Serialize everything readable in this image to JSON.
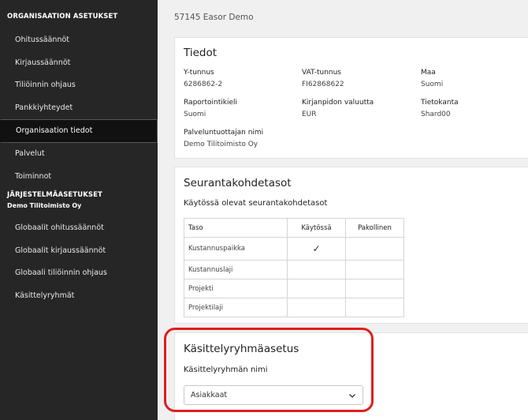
{
  "sidebar": {
    "org_header": "ORGANISAATION ASETUKSET",
    "org_items": [
      {
        "label": "Ohitussäännöt"
      },
      {
        "label": "Kirjaussäännöt"
      },
      {
        "label": "Tiliöinnin ohjaus"
      },
      {
        "label": "Pankkiyhteydet"
      },
      {
        "label": "Organisaation tiedot"
      },
      {
        "label": "Palvelut"
      },
      {
        "label": "Toiminnot"
      }
    ],
    "active_item": "Organisaation tiedot",
    "system_header": "JÄRJESTELMÄASETUKSET",
    "system_sub": "Demo Tilitoimisto Oy",
    "system_items": [
      {
        "label": "Globaalit ohitussäännöt"
      },
      {
        "label": "Globaalit kirjaussäännöt"
      },
      {
        "label": "Globaali tiliöinnin ohjaus"
      },
      {
        "label": "Käsittelyryhmät"
      }
    ]
  },
  "main": {
    "org_title": "57145 Easor Demo",
    "tiedot": {
      "title": "Tiedot",
      "fields": [
        {
          "label": "Y-tunnus",
          "value": "6286862-2"
        },
        {
          "label": "VAT-tunnus",
          "value": "FI62868622"
        },
        {
          "label": "Maa",
          "value": "Suomi"
        },
        {
          "label": "Raportointikieli",
          "value": "Suomi"
        },
        {
          "label": "Kirjanpidon valuutta",
          "value": "EUR"
        },
        {
          "label": "Tietokanta",
          "value": "Shard00"
        },
        {
          "label": "Palveluntuottajan nimi",
          "value": "Demo Tilitoimisto Oy"
        }
      ]
    },
    "seuranta": {
      "title": "Seurantakohdetasot",
      "subtitle": "Käytössä olevat seurantakohdetasot",
      "columns": [
        "Taso",
        "Käytössä",
        "Pakollinen"
      ],
      "rows": [
        {
          "taso": "Kustannuspaikka",
          "kaytossa": "✓",
          "pakollinen": ""
        },
        {
          "taso": "Kustannuslaji",
          "kaytossa": "",
          "pakollinen": ""
        },
        {
          "taso": "Projekti",
          "kaytossa": "",
          "pakollinen": ""
        },
        {
          "taso": "Projektilaji",
          "kaytossa": "",
          "pakollinen": ""
        }
      ]
    },
    "kasittely": {
      "title": "Käsittelyryhmäasetus",
      "field_label": "Käsittelyryhmän nimi",
      "selected_value": "Asiakkaat"
    }
  },
  "colors": {
    "sidebar_bg": "#262626",
    "content_bg": "#f0f0f0",
    "highlight": "#e01e1e"
  },
  "icons": [
    "checkmark-icon",
    "chevron-down-icon"
  ]
}
